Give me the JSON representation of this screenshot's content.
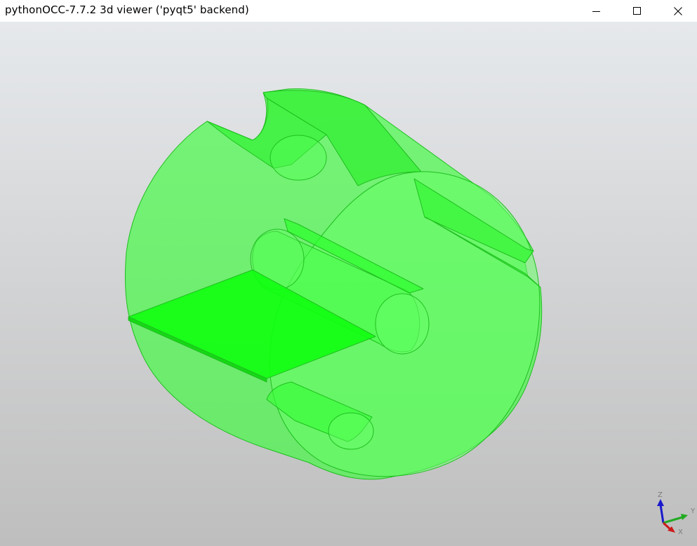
{
  "window": {
    "title": "pythonOCC-7.7.2 3d viewer ('pyqt5' backend)",
    "buttons": [
      {
        "name": "minimize",
        "icon": "minimize-icon"
      },
      {
        "name": "maximize",
        "icon": "maximize-icon"
      },
      {
        "name": "close",
        "icon": "close-icon"
      }
    ]
  },
  "viewer": {
    "background_top": "#e6e9ec",
    "background_bottom": "#bebebe",
    "shape_color": "#33ff33",
    "shape": "hollow cylinder with slots and inner plate (transparent)"
  },
  "trihedron": {
    "z_label": "Z",
    "y_label": "Y",
    "x_label": "X",
    "z_color": "#1a1acc",
    "y_color": "#22aa22",
    "x_color": "#cc1a1a"
  }
}
